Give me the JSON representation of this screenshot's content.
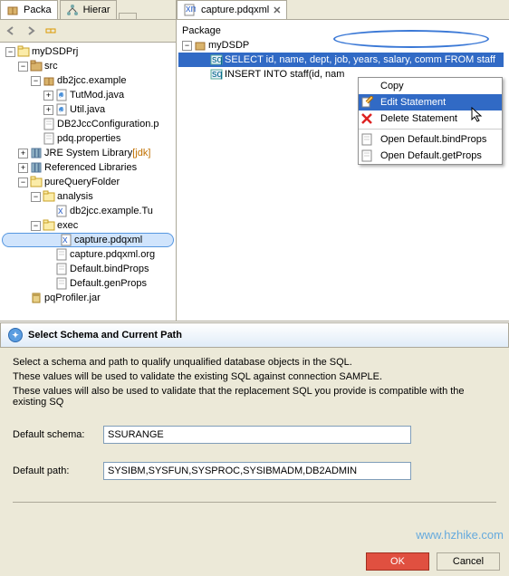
{
  "leftPane": {
    "tabs": [
      {
        "label": "Packa",
        "icon": "package"
      },
      {
        "label": "Hierar",
        "icon": "hierarchy"
      }
    ],
    "tree": [
      {
        "depth": 0,
        "exp": "-",
        "icon": "project",
        "label": "myDSDPrj"
      },
      {
        "depth": 1,
        "exp": "-",
        "icon": "srcfolder",
        "label": "src"
      },
      {
        "depth": 2,
        "exp": "-",
        "icon": "package",
        "label": "db2jcc.example"
      },
      {
        "depth": 3,
        "exp": "+",
        "icon": "java",
        "label": "TutMod.java"
      },
      {
        "depth": 3,
        "exp": "+",
        "icon": "java",
        "label": "Util.java"
      },
      {
        "depth": 2,
        "exp": "",
        "icon": "file",
        "label": "DB2JccConfiguration.p"
      },
      {
        "depth": 2,
        "exp": "",
        "icon": "file",
        "label": "pdq.properties"
      },
      {
        "depth": 1,
        "exp": "+",
        "icon": "library",
        "label": "JRE System Library",
        "decor": " [jdk]"
      },
      {
        "depth": 1,
        "exp": "+",
        "icon": "library",
        "label": "Referenced Libraries"
      },
      {
        "depth": 1,
        "exp": "-",
        "icon": "folder",
        "label": "pureQueryFolder"
      },
      {
        "depth": 2,
        "exp": "-",
        "icon": "folder",
        "label": "analysis"
      },
      {
        "depth": 3,
        "exp": "",
        "icon": "xml",
        "label": "db2jcc.example.Tu"
      },
      {
        "depth": 2,
        "exp": "-",
        "icon": "folder",
        "label": "exec"
      },
      {
        "depth": 3,
        "exp": "",
        "icon": "xml",
        "label": "capture.pdqxml",
        "circled": true
      },
      {
        "depth": 3,
        "exp": "",
        "icon": "file",
        "label": "capture.pdqxml.org"
      },
      {
        "depth": 3,
        "exp": "",
        "icon": "file",
        "label": "Default.bindProps"
      },
      {
        "depth": 3,
        "exp": "",
        "icon": "file",
        "label": "Default.genProps"
      },
      {
        "depth": 1,
        "exp": "",
        "icon": "jar",
        "label": "pqProfiler.jar"
      }
    ]
  },
  "editor": {
    "tabLabel": "capture.pdqxml",
    "packageHeader": "Package",
    "rows": [
      {
        "depth": 0,
        "exp": "-",
        "icon": "pkg",
        "label": "myDSDP",
        "sel": false
      },
      {
        "depth": 1,
        "exp": "",
        "icon": "sql",
        "label": "SELECT id, name, dept, job, years, salary, comm   FROM staff",
        "sel": true
      },
      {
        "depth": 1,
        "exp": "",
        "icon": "sql",
        "label": "INSERT INTO staff(id, nam",
        "sel": false
      }
    ]
  },
  "contextMenu": {
    "items": [
      {
        "label": "Copy",
        "icon": "",
        "hover": false
      },
      {
        "label": "Edit Statement",
        "icon": "edit",
        "hover": true
      },
      {
        "label": "Delete Statement",
        "icon": "delete",
        "hover": false
      },
      {
        "sep": true
      },
      {
        "label": "Open Default.bindProps",
        "icon": "file",
        "hover": false
      },
      {
        "label": "Open Default.getProps",
        "icon": "file",
        "hover": false
      }
    ]
  },
  "dialog": {
    "title": "Select Schema and Current Path",
    "desc1": "Select a schema and path to qualify unqualified database objects in the SQL.",
    "desc2": "These values will be used to validate the existing SQL against connection SAMPLE.",
    "desc3": "These values will also be used to validate that the replacement SQL you provide is compatible with the existing SQ",
    "schemaLabel": "Default schema:",
    "schemaValue": "SSURANGE",
    "pathLabel": "Default path:",
    "pathValue": "SYSIBM,SYSFUN,SYSPROC,SYSIBMADM,DB2ADMIN",
    "ok": "OK",
    "cancel": "Cancel"
  },
  "watermark": "www.hzhike.com"
}
